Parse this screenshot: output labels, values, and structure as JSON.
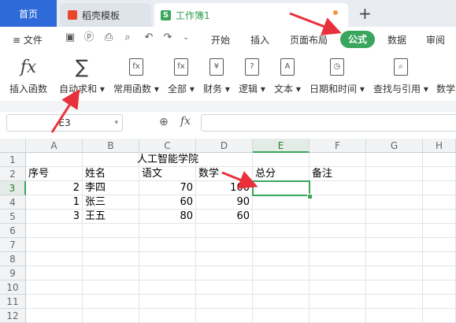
{
  "tabs": {
    "home": "首页",
    "template": "稻壳模板",
    "workbook": "工作簿1",
    "book_icon": "S",
    "new_tab": "+"
  },
  "menu": {
    "file": "文件",
    "items": [
      "开始",
      "插入",
      "页面布局",
      "公式",
      "数据",
      "审阅"
    ]
  },
  "ribbon": {
    "buttons": [
      {
        "label": "插入函数",
        "icon": "fx-icon"
      },
      {
        "label": "自动求和",
        "icon": "sigma-icon"
      },
      {
        "label": "常用函数",
        "icon": "function-box-icon"
      },
      {
        "label": "全部",
        "icon": "function-box-icon"
      },
      {
        "label": "财务",
        "icon": "yen-book-icon"
      },
      {
        "label": "逻辑",
        "icon": "question-book-icon"
      },
      {
        "label": "文本",
        "icon": "text-book-icon"
      },
      {
        "label": "日期和时间",
        "icon": "clock-book-icon"
      },
      {
        "label": "查找与引用",
        "icon": "search-book-icon"
      },
      {
        "label": "数学"
      }
    ],
    "fx_symbol": "fx",
    "sigma_symbol": "∑"
  },
  "formula_bar": {
    "name_box": "E3",
    "fx": "fx",
    "value": ""
  },
  "columns": [
    "A",
    "B",
    "C",
    "D",
    "E",
    "F",
    "G",
    "H"
  ],
  "rows": [
    "1",
    "2",
    "3",
    "4",
    "5",
    "6",
    "7",
    "8",
    "9",
    "10",
    "11",
    "12"
  ],
  "sheet": {
    "title": "人工智能学院",
    "headers": [
      "序号",
      "姓名",
      "语文",
      "数学",
      "总分",
      "备注"
    ],
    "data": [
      {
        "id": "2",
        "name": "李四",
        "chinese": "70",
        "math": "100"
      },
      {
        "id": "1",
        "name": "张三",
        "chinese": "60",
        "math": "90"
      },
      {
        "id": "3",
        "name": "王五",
        "chinese": "80",
        "math": "60"
      }
    ]
  },
  "colors": {
    "accent_green": "#3aa55c",
    "tab_blue": "#2f6bd8",
    "annotation_red": "#e8313a"
  }
}
